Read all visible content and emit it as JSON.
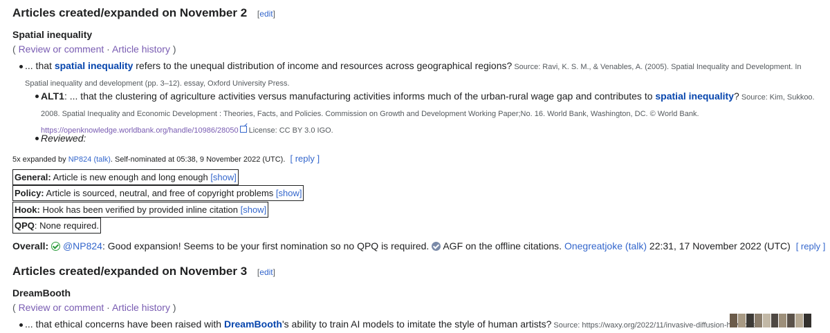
{
  "section1": {
    "heading": "Articles created/expanded on November 2",
    "edit_label": "edit",
    "article_title": "Spatial inequality",
    "review_label": "Review or comment",
    "history_label": "Article history",
    "hook": {
      "prefix": "... that ",
      "link": "spatial inequality",
      "rest": " refers to the unequal distribution of income and resources across geographical regions?",
      "source": " Source: Ravi, K. S. M., & Venables, A. (2005). Spatial Inequality and Development. In Spatial inequality and development (pp. 3–12). essay, Oxford University Press."
    },
    "alt1": {
      "label": "ALT1",
      "text": ": ... that the clustering of agriculture activities versus manufacturing activities informs much of the urban-rural wage gap and contributes to ",
      "link": "spatial inequality",
      "end": "?",
      "source": " Source: Kim, Sukkoo. 2008. Spatial Inequality and Economic Development : Theories, Facts, and Policies. Commission on Growth and Development Working Paper;No. 16. World Bank, Washington, DC. © World Bank.",
      "url": "https://openknowledge.worldbank.org/handle/10986/28050",
      "license": " License: CC BY 3.0 IGO."
    },
    "reviewed_label": "Reviewed",
    "nomination": {
      "prefix": "5x expanded by ",
      "user": "NP824",
      "talk": "(talk)",
      "suffix": ". Self-nominated at 05:38, 9 November 2022 (UTC).",
      "reply": "reply"
    },
    "checks": [
      {
        "label": "General:",
        "text": " Article is new enough and long enough ",
        "show": "[show]"
      },
      {
        "label": "Policy:",
        "text": " Article is sourced, neutral, and free of copyright problems ",
        "show": "[show]"
      },
      {
        "label": "Hook:",
        "text": " Hook has been verified by provided inline citation ",
        "show": "[show]"
      },
      {
        "label": "QPQ",
        "text": ": None required.",
        "show": ""
      }
    ],
    "overall": {
      "label": "Overall",
      "mention": "@NP824",
      "text": ": Good expansion! Seems to be your first nomination so no QPQ is required. ",
      "agf": " AGF on the offline citations. ",
      "user": "Onegreatjoke",
      "talk": "(talk)",
      "time": " 22:31, 17 November 2022 (UTC)",
      "reply": "reply"
    }
  },
  "section2": {
    "heading": "Articles created/expanded on November 3",
    "edit_label": "edit",
    "article_title": "DreamBooth",
    "review_label": "Review or comment",
    "history_label": "Article history",
    "hook_partial": "... that ethical concerns have been raised with ",
    "hook_link": "DreamBooth",
    "hook_rest": "'s ability to train AI models to imitate the style of human artists?",
    "source_partial": " Source: https://waxy.org/2022/11/invasive-diffusion-how-one"
  },
  "colors": {
    "link": "#3366cc",
    "visited": "#795cb2",
    "text": "#202122",
    "tick_green": "#2a9b3a"
  },
  "icons": [
    "external-link-icon",
    "green-tick-icon",
    "agf-tick-icon"
  ]
}
